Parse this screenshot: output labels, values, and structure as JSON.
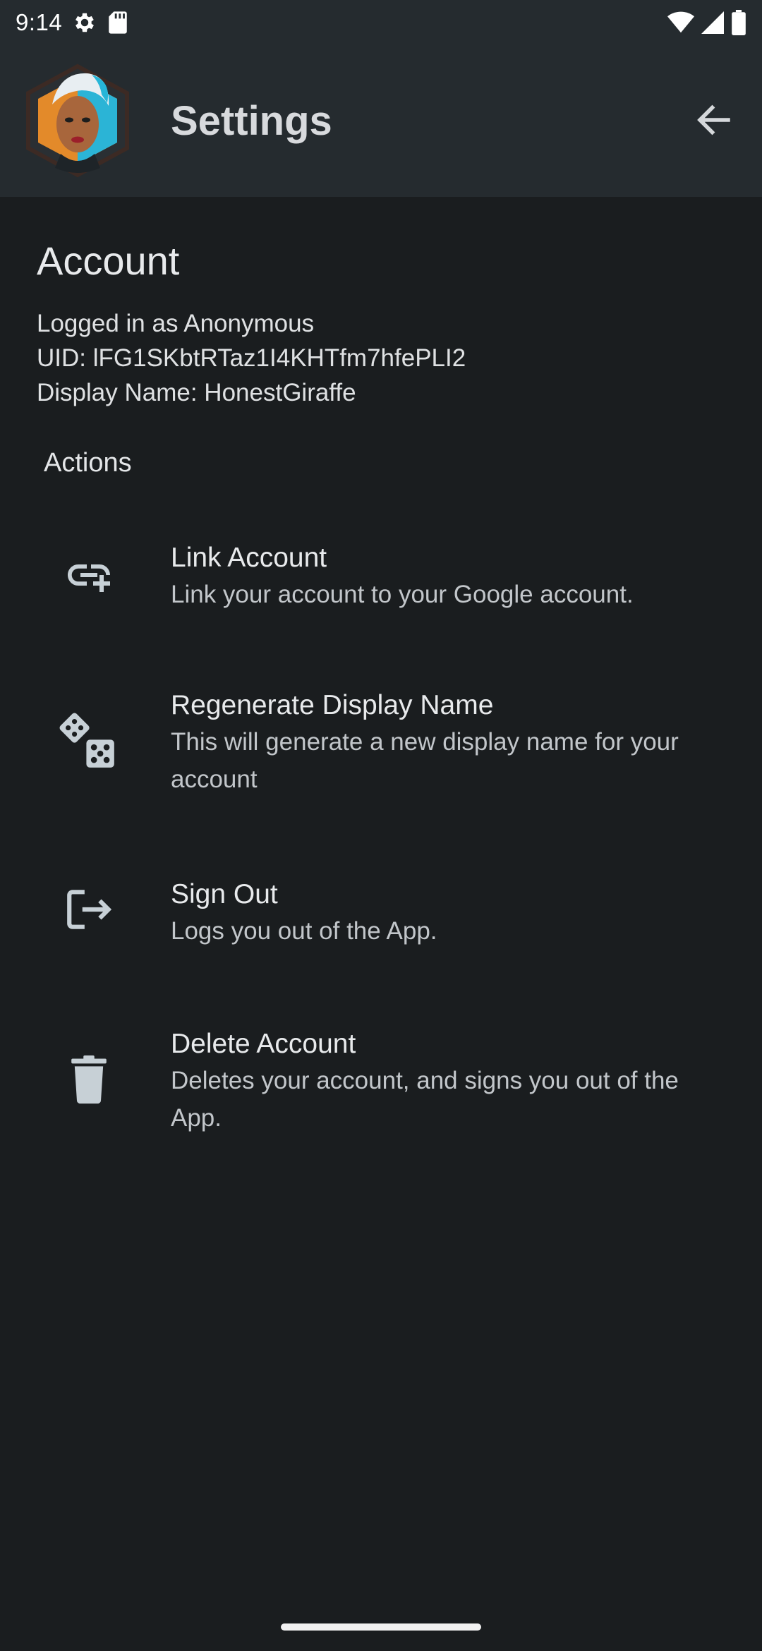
{
  "status_bar": {
    "time": "9:14",
    "icons": [
      "settings-gear-icon",
      "sd-card-icon",
      "wifi-icon",
      "signal-icon",
      "battery-icon"
    ]
  },
  "app_bar": {
    "title": "Settings",
    "avatar_icon": "avatar-icon",
    "back_icon": "arrow-back-icon"
  },
  "account": {
    "title": "Account",
    "logged_in_as": "Logged in as Anonymous",
    "uid": "UID: lFG1SKbtRTaz1I4KHTfm7hfePLI2",
    "display_name": "Display Name: HonestGiraffe"
  },
  "actions": {
    "header": "Actions",
    "items": [
      {
        "icon": "link-add-icon",
        "title": "Link Account",
        "description": "Link your account to your Google account."
      },
      {
        "icon": "dice-icon",
        "title": "Regenerate Display Name",
        "description": "This will generate a new display name for your account"
      },
      {
        "icon": "sign-out-icon",
        "title": "Sign Out",
        "description": "Logs you out of the App."
      },
      {
        "icon": "trash-icon",
        "title": "Delete Account",
        "description": "Deletes your account, and signs you out of the App."
      }
    ]
  },
  "colors": {
    "background": "#1a1d1f",
    "app_bar": "#252b2f",
    "icon": "#c7d0d6",
    "text_primary": "#e8eaec",
    "text_secondary": "#c2c6ca"
  }
}
